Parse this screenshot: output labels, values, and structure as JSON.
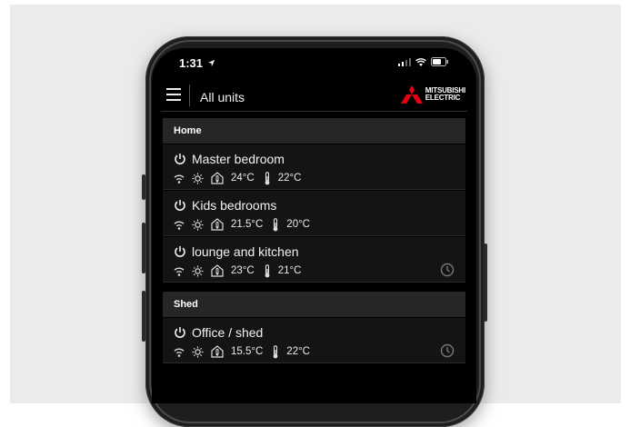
{
  "status_bar": {
    "time": "1:31"
  },
  "header": {
    "title": "All units",
    "brand_line1": "MITSUBISHI",
    "brand_line2": "ELECTRIC"
  },
  "groups": [
    {
      "name": "Home",
      "units": [
        {
          "name": "Master bedroom",
          "room_temp": "24°C",
          "set_temp": "22°C",
          "schedule": false
        },
        {
          "name": "Kids bedrooms",
          "room_temp": "21.5°C",
          "set_temp": "20°C",
          "schedule": false
        },
        {
          "name": "lounge and kitchen",
          "room_temp": "23°C",
          "set_temp": "21°C",
          "schedule": true
        }
      ]
    },
    {
      "name": "Shed",
      "units": [
        {
          "name": "Office / shed",
          "room_temp": "15.5°C",
          "set_temp": "22°C",
          "schedule": true
        }
      ]
    }
  ],
  "icons": {
    "power": "power-icon",
    "wifi": "wifi-icon",
    "mode": "sun-icon",
    "room": "house-thermometer-icon",
    "setpoint": "thermometer-icon",
    "schedule": "clock-icon"
  },
  "colors": {
    "screen_bg": "#000000",
    "group_bg": "#262626",
    "unit_bg": "#141414",
    "brand_red": "#e60012"
  }
}
